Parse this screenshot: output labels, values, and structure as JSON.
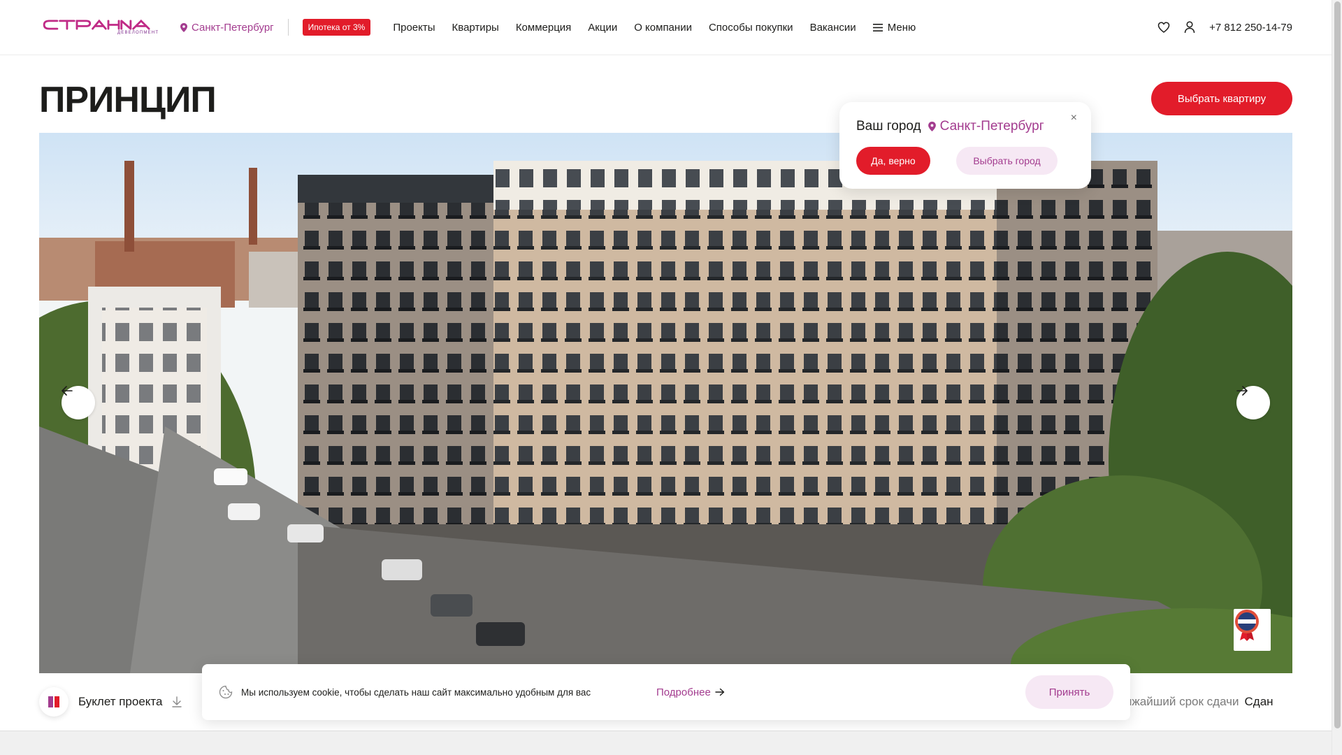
{
  "header": {
    "logo_text": "СТРАНА",
    "logo_subtext": "девелопмент",
    "city": "Санкт-Петербург",
    "promo_badge": "Ипотека от 3%",
    "nav": [
      "Проекты",
      "Квартиры",
      "Коммерция",
      "Акции",
      "О компании",
      "Способы покупки",
      "Вакансии"
    ],
    "menu_label": "Меню",
    "phone": "+7 812 250-14-79"
  },
  "page": {
    "title": "ПРИНЦИП",
    "cta_label": "Выбрать квартиру"
  },
  "city_popup": {
    "question": "Ваш город",
    "city": "Санкт-Петербург",
    "confirm_label": "Да, верно",
    "change_label": "Выбрать город",
    "close_symbol": "×"
  },
  "info_row": {
    "booklet_label": "Буклет проекта",
    "deadline_label": "лижайший срок сдачи",
    "deadline_value": "Сдан"
  },
  "cookie": {
    "text": "Мы используем cookie, чтобы сделать наш сайт максимально удобным для вас",
    "more_label": "Подробнее",
    "accept_label": "Принять"
  },
  "colors": {
    "brand_red": "#e21c2a",
    "brand_purple": "#a33c8f",
    "soft_pink": "#f6e8f4"
  }
}
